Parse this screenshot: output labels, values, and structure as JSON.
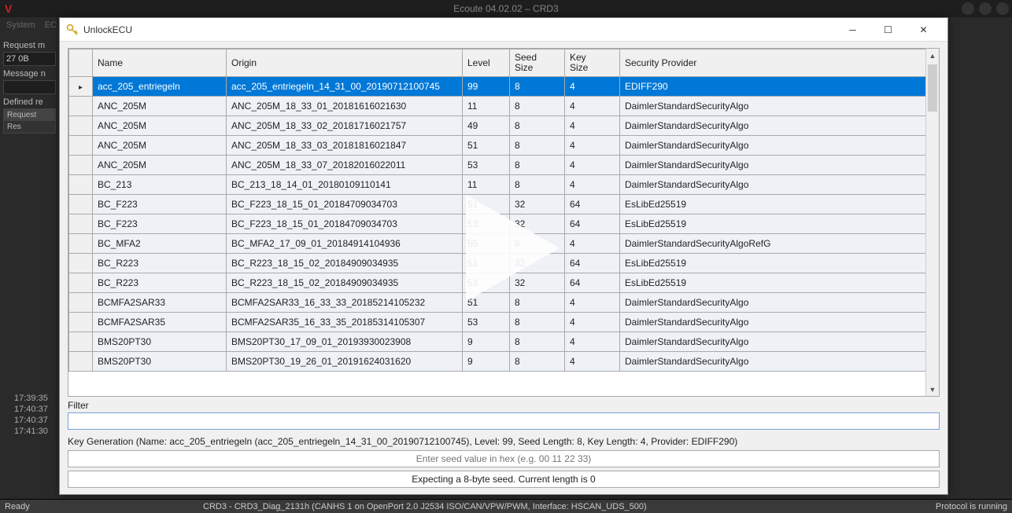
{
  "outer": {
    "title": "Ecoute 04.02.02 – CRD3",
    "menu": [
      "System",
      "EC"
    ],
    "left": {
      "request_m_label": "Request m",
      "request_m_value": "27 0B",
      "message_n_label": "Message n",
      "message_n_value": "",
      "defined_label": "Defined re",
      "box_head": "Request",
      "box_row": "Res"
    },
    "timestamps": [
      "17:39:35",
      "17:40:37",
      "17:40:37",
      "17:41:30"
    ],
    "status_left": "Ready",
    "status_center": "CRD3 - CRD3_Diag_2131h (CANHS 1 on OpenPort 2.0 J2534 ISO/CAN/VPW/PWM, Interface: HSCAN_UDS_500)",
    "status_right": "Protocol is running"
  },
  "dialog": {
    "title": "UnlockECU",
    "columns": [
      "Name",
      "Origin",
      "Level",
      "Seed Size",
      "Key Size",
      "Security Provider"
    ],
    "rows": [
      {
        "name": "acc_205_entriegeln",
        "origin": "acc_205_entriegeln_14_31_00_20190712100745",
        "level": "99",
        "seed": "8",
        "key": "4",
        "prov": "EDIFF290",
        "sel": true
      },
      {
        "name": "ANC_205M",
        "origin": "ANC_205M_18_33_01_20181616021630",
        "level": "11",
        "seed": "8",
        "key": "4",
        "prov": "DaimlerStandardSecurityAlgo"
      },
      {
        "name": "ANC_205M",
        "origin": "ANC_205M_18_33_02_20181716021757",
        "level": "49",
        "seed": "8",
        "key": "4",
        "prov": "DaimlerStandardSecurityAlgo"
      },
      {
        "name": "ANC_205M",
        "origin": "ANC_205M_18_33_03_20181816021847",
        "level": "51",
        "seed": "8",
        "key": "4",
        "prov": "DaimlerStandardSecurityAlgo"
      },
      {
        "name": "ANC_205M",
        "origin": "ANC_205M_18_33_07_20182016022011",
        "level": "53",
        "seed": "8",
        "key": "4",
        "prov": "DaimlerStandardSecurityAlgo"
      },
      {
        "name": "BC_213",
        "origin": "BC_213_18_14_01_20180109110141",
        "level": "11",
        "seed": "8",
        "key": "4",
        "prov": "DaimlerStandardSecurityAlgo"
      },
      {
        "name": "BC_F223",
        "origin": "BC_F223_18_15_01_20184709034703",
        "level": "51",
        "seed": "32",
        "key": "64",
        "prov": "EsLibEd25519"
      },
      {
        "name": "BC_F223",
        "origin": "BC_F223_18_15_01_20184709034703",
        "level": "53",
        "seed": "32",
        "key": "64",
        "prov": "EsLibEd25519"
      },
      {
        "name": "BC_MFA2",
        "origin": "BC_MFA2_17_09_01_20184914104936",
        "level": "55",
        "seed": "8",
        "key": "4",
        "prov": "DaimlerStandardSecurityAlgoRefG"
      },
      {
        "name": "BC_R223",
        "origin": "BC_R223_18_15_02_20184909034935",
        "level": "51",
        "seed": "32",
        "key": "64",
        "prov": "EsLibEd25519"
      },
      {
        "name": "BC_R223",
        "origin": "BC_R223_18_15_02_20184909034935",
        "level": "53",
        "seed": "32",
        "key": "64",
        "prov": "EsLibEd25519"
      },
      {
        "name": "BCMFA2SAR33",
        "origin": "BCMFA2SAR33_16_33_33_20185214105232",
        "level": "51",
        "seed": "8",
        "key": "4",
        "prov": "DaimlerStandardSecurityAlgo"
      },
      {
        "name": "BCMFA2SAR35",
        "origin": "BCMFA2SAR35_16_33_35_20185314105307",
        "level": "53",
        "seed": "8",
        "key": "4",
        "prov": "DaimlerStandardSecurityAlgo"
      },
      {
        "name": "BMS20PT30",
        "origin": "BMS20PT30_17_09_01_20193930023908",
        "level": "9",
        "seed": "8",
        "key": "4",
        "prov": "DaimlerStandardSecurityAlgo"
      },
      {
        "name": "BMS20PT30",
        "origin": "BMS20PT30_19_26_01_20191624031620",
        "level": "9",
        "seed": "8",
        "key": "4",
        "prov": "DaimlerStandardSecurityAlgo"
      }
    ],
    "filter_label": "Filter",
    "filter_value": "",
    "keygen_label": "Key Generation (Name: acc_205_entriegeln (acc_205_entriegeln_14_31_00_20190712100745), Level: 99, Seed Length: 8, Key Length: 4, Provider: EDIFF290)",
    "seed_placeholder": "Enter seed value in hex (e.g. 00 11 22 33)",
    "seed_status": "Expecting a 8-byte seed. Current length is 0"
  }
}
